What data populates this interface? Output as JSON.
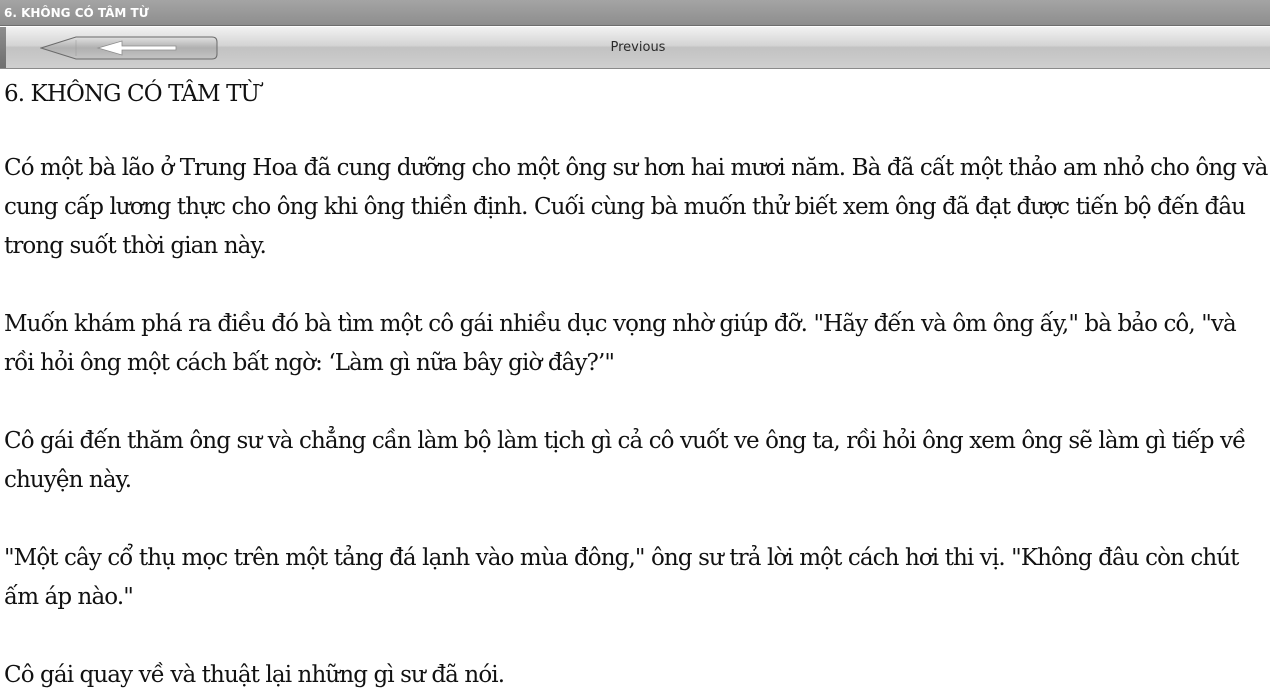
{
  "window": {
    "title": "6. KHÔNG CÓ TÂM TỪ"
  },
  "toolbar": {
    "back_icon": "left-arrow-icon",
    "previous_label": "Previous"
  },
  "article": {
    "heading": "6. KHÔNG CÓ TÂM TỪ",
    "paragraphs": [
      "Có một bà lão ở Trung Hoa đã cung dưỡng cho một ông sư hơn hai mươi năm. Bà đã cất một thảo am nhỏ cho ông và cung cấp lương thực cho ông khi ông thiền định. Cuối cùng bà muốn thử biết xem ông đã đạt được tiến bộ đến đâu trong suốt thời gian này.",
      "Muốn khám phá ra điều đó bà tìm một cô gái nhiều dục vọng nhờ giúp đỡ. \"Hãy đến và ôm ông ấy,\" bà bảo cô, \"và rồi hỏi ông một cách bất ngờ: ‘Làm gì nữa bây giờ đây?’\"",
      "Cô gái đến thăm ông sư và chẳng cần làm bộ làm tịch gì cả cô vuốt ve ông ta, rồi hỏi ông xem ông sẽ làm gì tiếp về chuyện này.",
      "\"Một cây cổ thụ mọc trên một tảng đá lạnh vào mùa đông,\" ông sư trả lời một cách hơi thi vị. \"Không đâu còn chút ấm áp nào.\"",
      "Cô gái quay về và thuật lại những gì sư đã nói."
    ]
  }
}
